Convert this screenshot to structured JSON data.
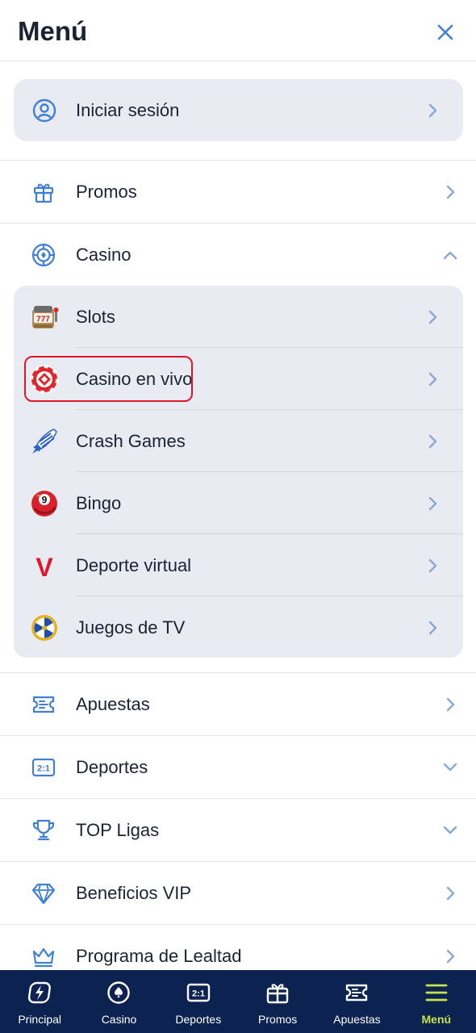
{
  "header": {
    "title": "Menú"
  },
  "login": {
    "label": "Iniciar sesión"
  },
  "menu": {
    "promos": "Promos",
    "casino": "Casino",
    "apuestas": "Apuestas",
    "deportes": "Deportes",
    "top_ligas": "TOP Ligas",
    "beneficios_vip": "Beneficios VIP",
    "programa_lealtad": "Programa de Lealtad"
  },
  "casino_submenu": {
    "slots": "Slots",
    "casino_en_vivo": "Casino en vivo",
    "crash_games": "Crash Games",
    "bingo": "Bingo",
    "deporte_virtual": "Deporte virtual",
    "juegos_tv": "Juegos de TV"
  },
  "icons": {
    "slots_text": "777",
    "bingo_text": "9",
    "virtual_text": "V",
    "deportes_text": "2:1"
  },
  "tabs": {
    "principal": "Principal",
    "casino": "Casino",
    "deportes": "Deportes",
    "promos": "Promos",
    "apuestas": "Apuestas",
    "menu": "Menú"
  },
  "colors": {
    "accent_blue": "#3f7fd6",
    "chevron": "#8aa7d6",
    "card_bg": "#e8ebf1",
    "tabbar_bg": "#0c2250",
    "active_tab": "#c8e34a",
    "highlight": "#e0162b"
  }
}
